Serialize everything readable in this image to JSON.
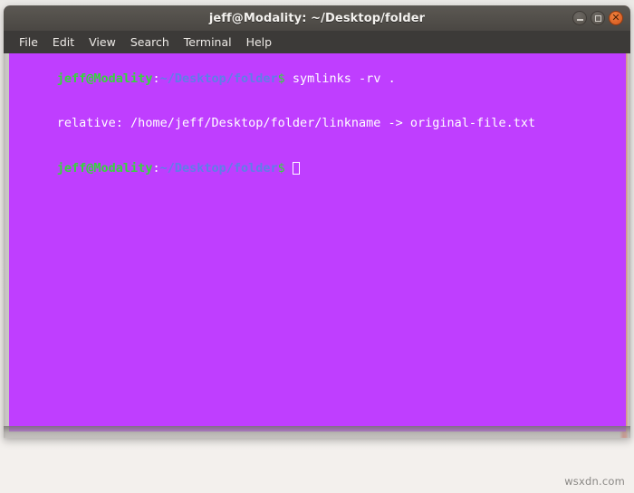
{
  "window": {
    "title": "jeff@Modality: ~/Desktop/folder",
    "controls": [
      {
        "name": "minimize",
        "label": "–"
      },
      {
        "name": "maximize",
        "label": "□"
      },
      {
        "name": "close",
        "label": "✕"
      }
    ],
    "accent_color": "#d4571f",
    "titlebar_color": "#53504b"
  },
  "menu": {
    "items": [
      {
        "label": "File"
      },
      {
        "label": "Edit"
      },
      {
        "label": "View"
      },
      {
        "label": "Search"
      },
      {
        "label": "Terminal"
      },
      {
        "label": "Help"
      }
    ]
  },
  "terminal": {
    "background_color": "#bf3eff",
    "foreground_color": "#ffffff",
    "prompt_user_color": "#35d63a",
    "prompt_path_color": "#5f7ee8",
    "lines": [
      {
        "type": "prompt",
        "user": "jeff@Modality",
        "colon": ":",
        "path": "~/Desktop/folder",
        "dollar": "$",
        "command": " symlinks -rv .",
        "cursor": false
      },
      {
        "type": "output",
        "text": "relative: /home/jeff/Desktop/folder/linkname -> original-file.txt"
      },
      {
        "type": "prompt",
        "user": "jeff@Modality",
        "colon": ":",
        "path": "~/Desktop/folder",
        "dollar": "$",
        "command": " ",
        "cursor": true
      }
    ]
  },
  "watermark": {
    "text": "wsxdn.com"
  }
}
